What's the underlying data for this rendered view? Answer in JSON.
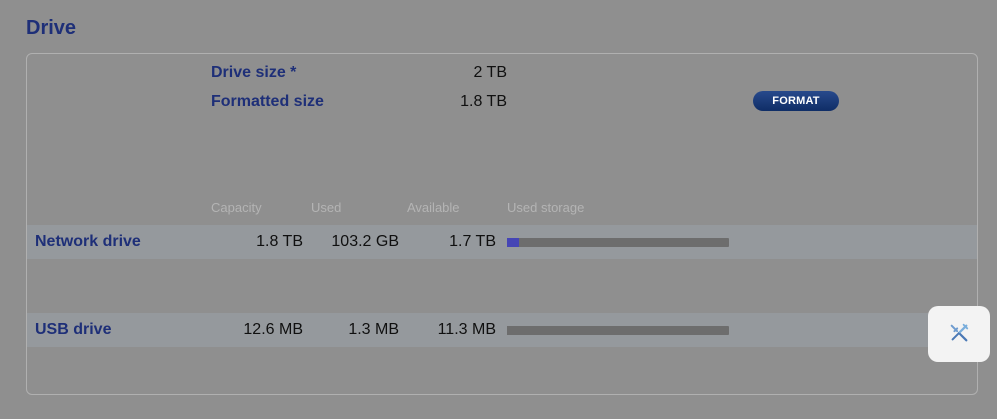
{
  "section": {
    "title": "Drive"
  },
  "summary": {
    "drive_size_label": "Drive size *",
    "drive_size_value": "2 TB",
    "formatted_size_label": "Formatted size",
    "formatted_size_value": "1.8 TB",
    "format_button": "FORMAT"
  },
  "table": {
    "headers": [
      "Capacity",
      "Used",
      "Available",
      "Used storage"
    ],
    "rows": [
      {
        "label": "Network drive",
        "capacity": "1.8 TB",
        "used": "103.2 GB",
        "available": "1.7 TB",
        "used_fraction": 0.056
      },
      {
        "label": "USB drive",
        "capacity": "12.6 MB",
        "used": "1.3 MB",
        "available": "11.3 MB",
        "used_fraction": 0.103
      }
    ]
  },
  "icons": {
    "tools": "tools-icon"
  },
  "colors": {
    "accent": "#1e2f78",
    "bar_fill": "#4545b5",
    "bar_track": "#6d6d6d"
  }
}
